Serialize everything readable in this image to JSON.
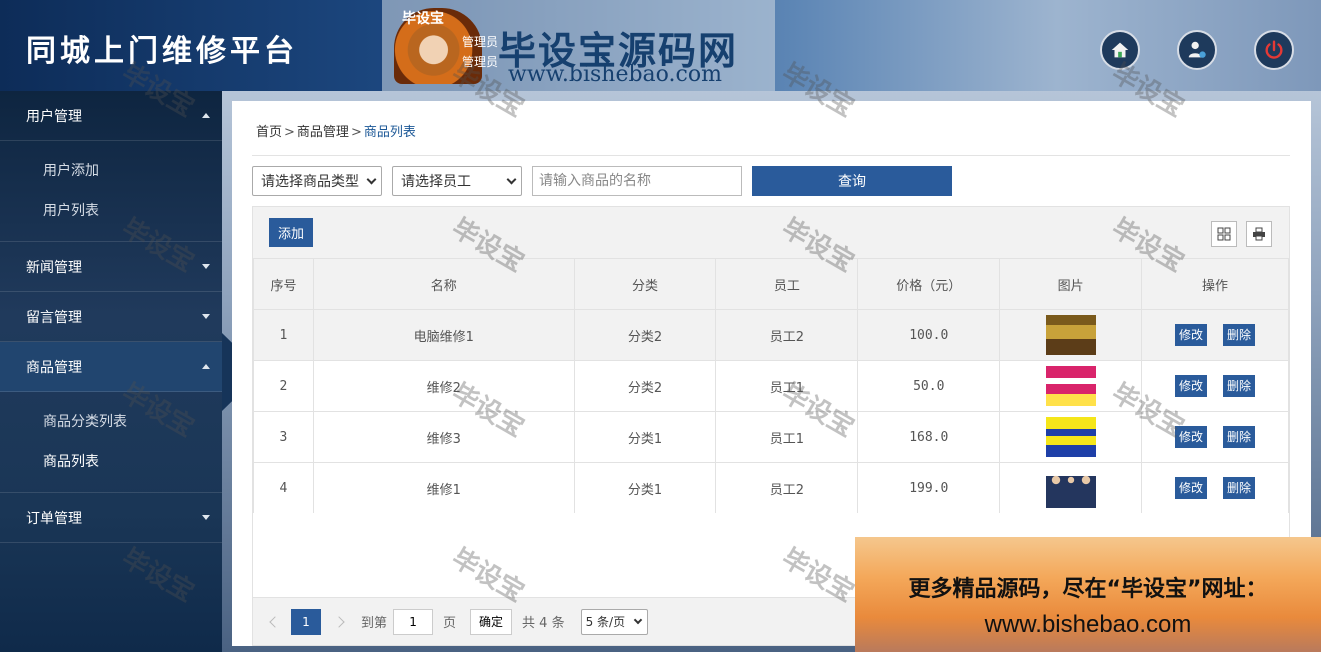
{
  "header": {
    "title": "同城上门维修平台",
    "banner_logo_text": "毕设宝",
    "banner_title": "毕设宝源码网",
    "banner_url": "www.bishebao.com",
    "role_line1": "管理员",
    "role_line2": "管理员",
    "buttons": [
      "home-icon",
      "user-settings-icon",
      "power-icon"
    ]
  },
  "sidebar": {
    "menus": [
      {
        "label": "用户管理",
        "expanded": true,
        "items": [
          "用户添加",
          "用户列表"
        ]
      },
      {
        "label": "新闻管理",
        "expanded": false
      },
      {
        "label": "留言管理",
        "expanded": false
      },
      {
        "label": "商品管理",
        "expanded": true,
        "items": [
          "商品分类列表",
          "商品列表"
        ]
      },
      {
        "label": "订单管理",
        "expanded": false
      }
    ]
  },
  "breadcrumb": {
    "home": "首页",
    "section": "商品管理",
    "current": "商品列表",
    "separator": ">"
  },
  "filters": {
    "type_select": "请选择商品类型",
    "staff_select": "请选择员工",
    "name_placeholder": "请输入商品的名称",
    "query_label": "查询"
  },
  "table": {
    "add_label": "添加",
    "columns": [
      "序号",
      "名称",
      "分类",
      "员工",
      "价格（元）",
      "图片",
      "操作"
    ],
    "rows": [
      {
        "no": "1",
        "name": "电脑维修1",
        "category": "分类2",
        "staff": "员工2",
        "price": "100.0"
      },
      {
        "no": "2",
        "name": "维修2",
        "category": "分类2",
        "staff": "员工1",
        "price": "50.0"
      },
      {
        "no": "3",
        "name": "维修3",
        "category": "分类1",
        "staff": "员工1",
        "price": "168.0"
      },
      {
        "no": "4",
        "name": "维修1",
        "category": "分类1",
        "staff": "员工2",
        "price": "199.0"
      }
    ],
    "edit_label": "修改",
    "delete_label": "删除"
  },
  "pager": {
    "current_page": "1",
    "goto_prefix": "到第",
    "goto_value": "1",
    "goto_suffix": "页",
    "confirm_label": "确定",
    "total_text": "共 4 条",
    "page_size": "5 条/页"
  },
  "watermark": "毕设宝",
  "promo": {
    "line1": "更多精品源码，尽在“毕设宝”网址：",
    "line2": "www.bishebao.com"
  }
}
